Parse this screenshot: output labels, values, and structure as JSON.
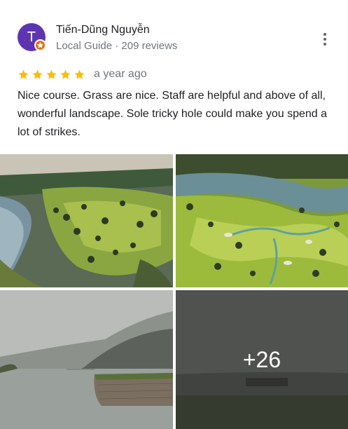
{
  "author": {
    "initial": "T",
    "name": "Tiến-Dũng Nguyễn",
    "meta": "Local Guide · 209 reviews",
    "avatar_color": "#5e35b1",
    "badge_color": "#e8710a"
  },
  "review": {
    "rating": 5,
    "max_rating": 5,
    "star_color": "#fbbc04",
    "time_ago": "a year ago",
    "text": "Nice course. Grass are nice. Staff are helpful and above of all, wonderful landscape. Sole tricky hole could make you spend a lot of strikes."
  },
  "photos": {
    "more_count_label": "+26"
  },
  "icons": {
    "more": "more-vert-icon",
    "star": "star-icon",
    "badge": "local-guide-badge-icon"
  }
}
